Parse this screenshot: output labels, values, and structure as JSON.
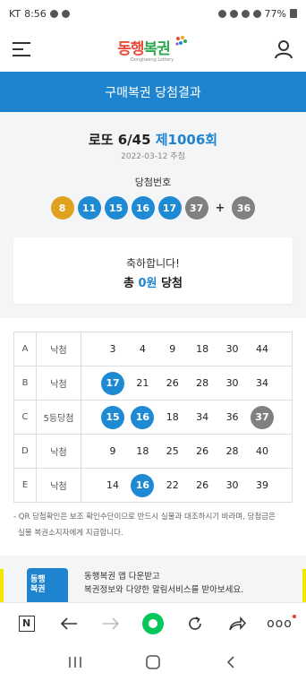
{
  "status_bar": {
    "carrier": "KT",
    "time": "8:56",
    "battery": "77%"
  },
  "header": {
    "logo_part1": "동행",
    "logo_part2": "복권",
    "logo_sub": "Donghaeng Lottery"
  },
  "page_title": "구매복권 당첨결과",
  "draw": {
    "game": "로또 6/45",
    "round": "제1006회",
    "date": "2022-03-12 추첨",
    "winning_label": "당첨번호",
    "winning_numbers": [
      "8",
      "11",
      "15",
      "16",
      "17",
      "37"
    ],
    "plus": "+",
    "bonus": "36"
  },
  "result": {
    "congrats": "축하합니다!",
    "total_prefix": "총",
    "amount": "0원",
    "total_suffix": "당첨"
  },
  "tickets": [
    {
      "row": "A",
      "result": "낙첨",
      "numbers": [
        "3",
        "4",
        "9",
        "18",
        "30",
        "44"
      ]
    },
    {
      "row": "B",
      "result": "낙첨",
      "numbers": [
        "17",
        "21",
        "26",
        "28",
        "30",
        "34"
      ]
    },
    {
      "row": "C",
      "result": "5등당첨",
      "numbers": [
        "15",
        "16",
        "18",
        "34",
        "36",
        "37"
      ]
    },
    {
      "row": "D",
      "result": "낙첨",
      "numbers": [
        "9",
        "18",
        "25",
        "26",
        "28",
        "40"
      ]
    },
    {
      "row": "E",
      "result": "낙첨",
      "numbers": [
        "14",
        "16",
        "22",
        "26",
        "30",
        "39"
      ]
    }
  ],
  "note_line1": "- QR 당첨확인은 보조 확인수단이므로 반드시 실물과 대조하시기 바라며, 당첨금은",
  "note_line2": "실물 복권소지자에게 지급합니다.",
  "banner": {
    "icon_line1": "동행",
    "icon_line2": "복권",
    "line1": "동행복권 앱 다운받고",
    "line2": "복권정보와 다양한 알림서비스를 받아보세요."
  },
  "browser_bar": {
    "n_label": "N",
    "more_label": "ooo"
  },
  "colors": {
    "primary": "#1f84d0",
    "ball_yellow": "#e0a020",
    "ball_blue": "#1f8ad4",
    "ball_gray": "#808080",
    "naver_green": "#03c75a"
  }
}
